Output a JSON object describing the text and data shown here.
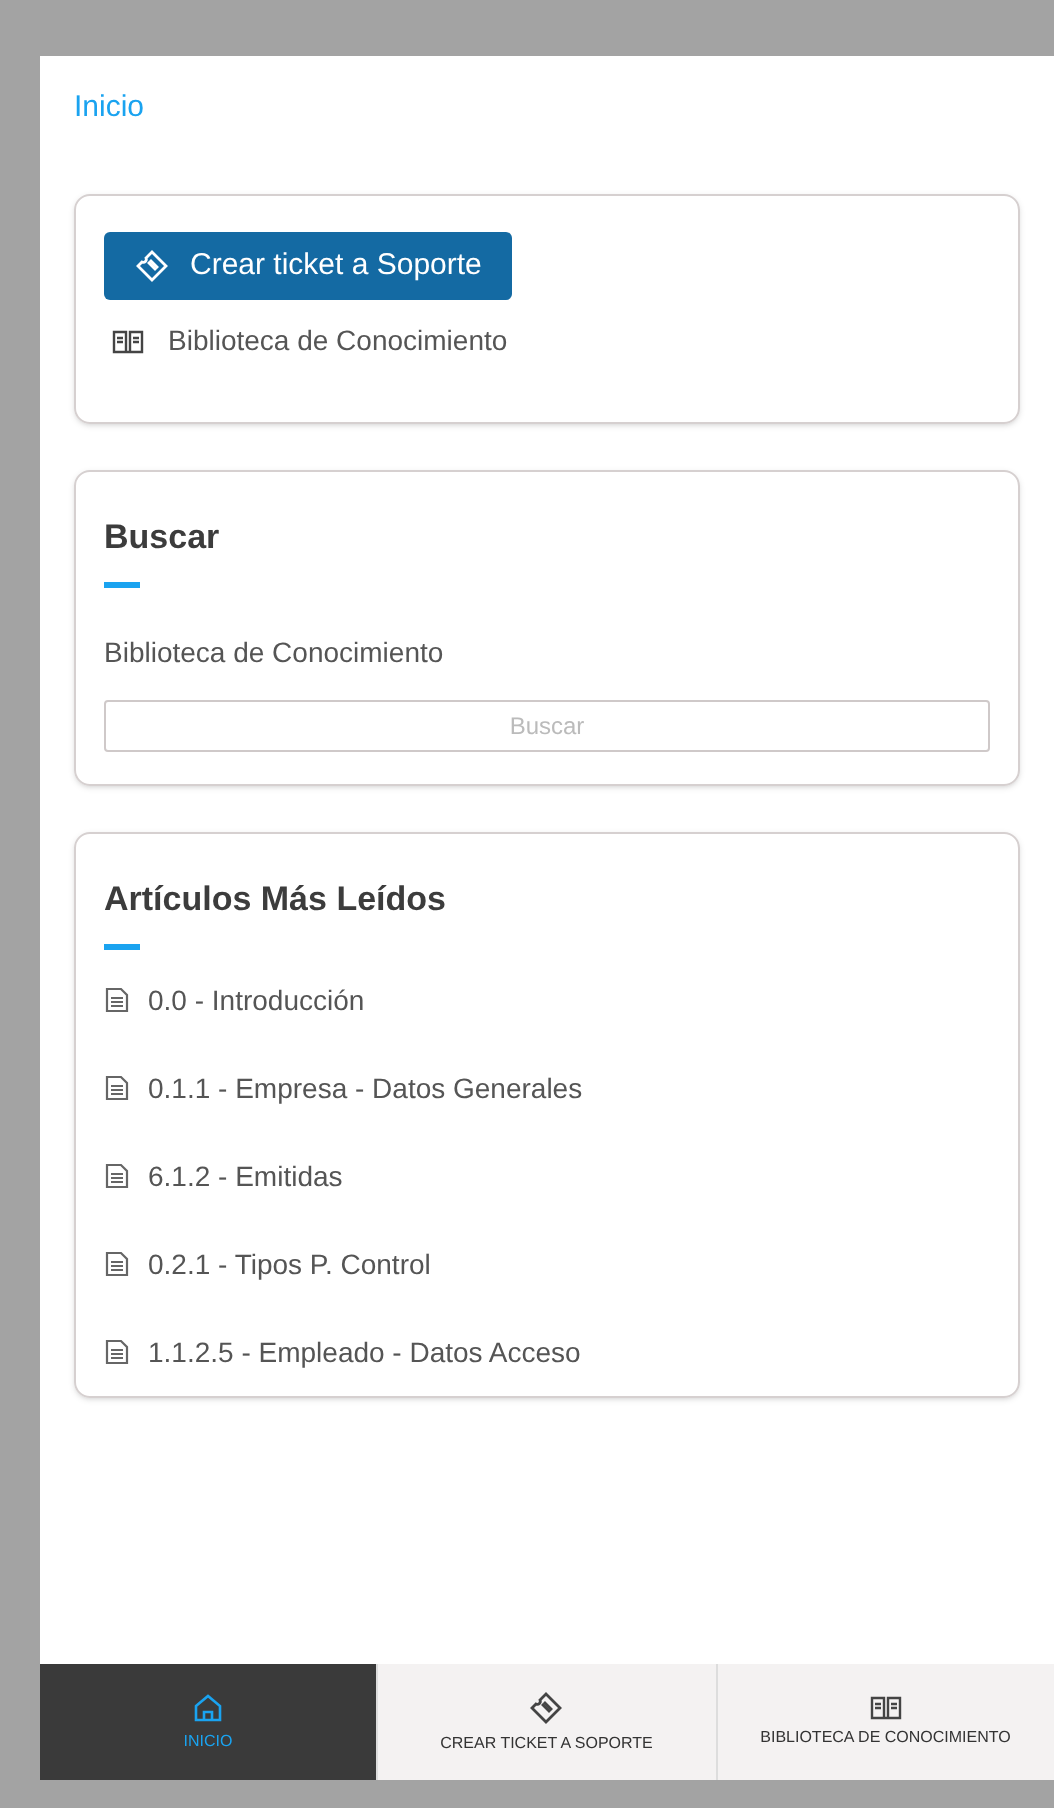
{
  "breadcrumb": "Inicio",
  "actions_card": {
    "button": "Crear ticket a Soporte",
    "link": "Biblioteca de Conocimiento"
  },
  "search_card": {
    "title": "Buscar",
    "label": "Biblioteca de Conocimiento",
    "field": {
      "placeholder": "Buscar"
    }
  },
  "articles_card": {
    "title": "Artículos Más Leídos",
    "items": [
      "0.0 - Introducción",
      "0.1.1 - Empresa - Datos Generales",
      "6.1.2 - Emitidas",
      "0.2.1 - Tipos P. Control",
      "1.1.2.5 - Empleado - Datos Acceso"
    ]
  },
  "bottom_nav": [
    {
      "label": "INICIO",
      "kind": "home",
      "selected": true
    },
    {
      "label": "CREAR TICKET A SOPORTE",
      "kind": "ticket",
      "selected": false
    },
    {
      "label": "BIBLIOTECA DE CONOCIMIENTO",
      "kind": "book",
      "selected": false
    }
  ]
}
